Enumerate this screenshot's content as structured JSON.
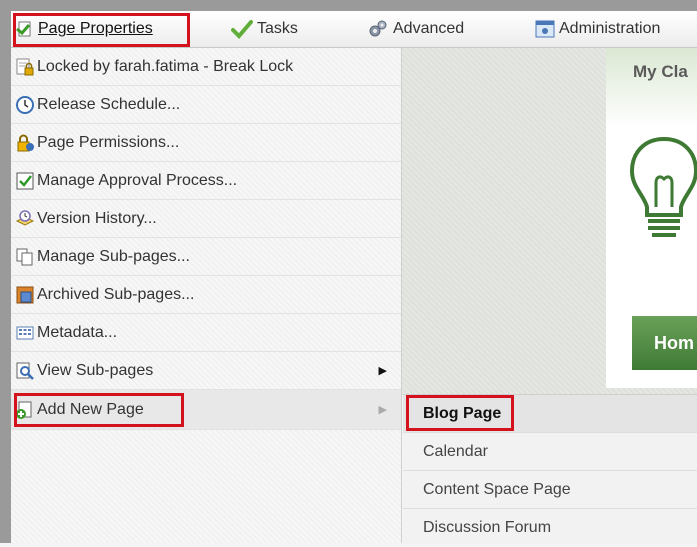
{
  "menubar": {
    "tabs": [
      {
        "label": "Page Properties",
        "icon": "page-properties-icon"
      },
      {
        "label": "Tasks",
        "icon": "tasks-check-icon"
      },
      {
        "label": "Advanced",
        "icon": "gears-icon"
      },
      {
        "label": "Administration",
        "icon": "administration-icon"
      }
    ]
  },
  "dropdown": {
    "items": [
      {
        "label": "Locked by farah.fatima - Break Lock",
        "icon": "lock-page-icon"
      },
      {
        "label": "Release Schedule...",
        "icon": "clock-icon"
      },
      {
        "label": "Page Permissions...",
        "icon": "permissions-lock-icon"
      },
      {
        "label": "Manage Approval Process...",
        "icon": "approval-check-icon"
      },
      {
        "label": "Version History...",
        "icon": "version-history-icon"
      },
      {
        "label": "Manage Sub-pages...",
        "icon": "sub-pages-icon"
      },
      {
        "label": "Archived Sub-pages...",
        "icon": "archive-icon"
      },
      {
        "label": "Metadata...",
        "icon": "metadata-icon"
      },
      {
        "label": "View Sub-pages",
        "icon": "view-pages-icon",
        "has_submenu": true
      },
      {
        "label": "Add New Page",
        "icon": "add-page-icon",
        "has_submenu": true,
        "active": true
      }
    ]
  },
  "submenu": {
    "items": [
      {
        "label": "Blog Page"
      },
      {
        "label": "Calendar"
      },
      {
        "label": "Content Space Page"
      },
      {
        "label": "Discussion Forum"
      }
    ]
  },
  "content": {
    "card_title": "My Cla",
    "home_button": "Hom"
  },
  "colors": {
    "highlight": "#d4121e",
    "accent_green": "#4e8a42"
  }
}
